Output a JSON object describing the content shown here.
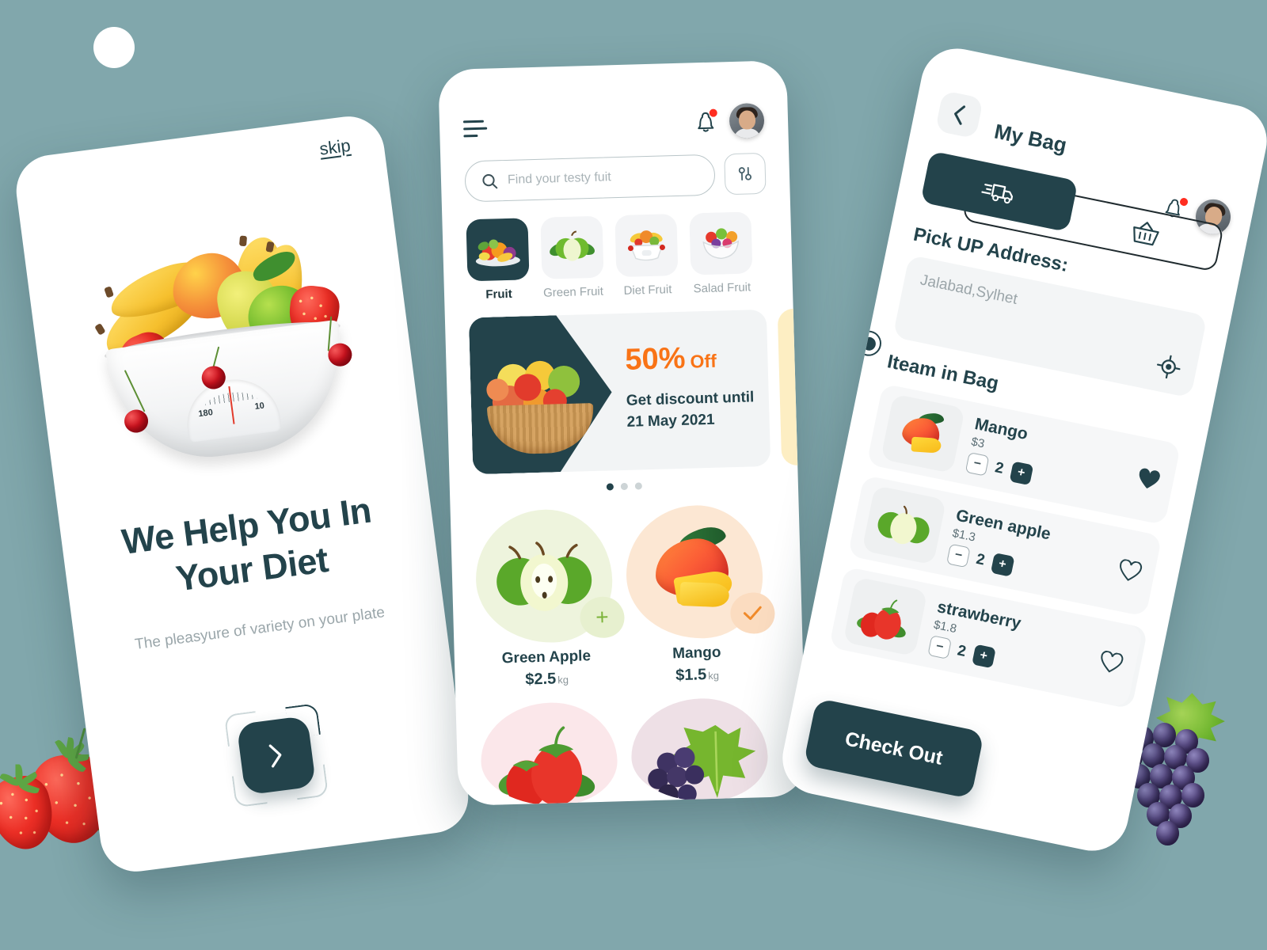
{
  "theme": {
    "background": "#81a7ac",
    "primary_dark": "#23434b",
    "accent_orange": "#f97316",
    "muted_text": "#9aa5a9",
    "card_grey": "#f3f4f6"
  },
  "onboarding": {
    "skip_label": "skip",
    "headline": "We Help You In Your Diet",
    "subtitle": "The pleasyure of variety on your plate",
    "next_icon": "chevron-right-icon",
    "illustration": "fruit-bowl-with-scale",
    "scale_left_number": "180",
    "scale_right_number": "10"
  },
  "home": {
    "menu_icon": "hamburger-menu-icon",
    "bell_icon": "notification-bell-icon",
    "has_notification": true,
    "avatar": "user-avatar",
    "search": {
      "icon": "search-icon",
      "placeholder": "Find your testy fuit",
      "value": ""
    },
    "filter_icon": "filter-sliders-icon",
    "categories": [
      {
        "label": "Fruit",
        "icon": "mixed-fruit-platter",
        "active": true
      },
      {
        "label": "Green Fruit",
        "icon": "green-apple-leaves",
        "active": false
      },
      {
        "label": "Diet Fruit",
        "icon": "fruit-bowl-scale",
        "active": false
      },
      {
        "label": "Salad Fruit",
        "icon": "fruit-salad-bowl",
        "active": false
      }
    ],
    "promo": {
      "percent": "50%",
      "off_label": "Off",
      "text": "Get discount until 21 May 2021",
      "image": "fruit-basket"
    },
    "carousel_dots": 3,
    "carousel_active_index": 0,
    "products": [
      {
        "name": "Green Apple",
        "price": "$2.5",
        "unit": "kg",
        "action": "add",
        "action_icon": "plus-icon"
      },
      {
        "name": "Mango",
        "price": "$1.5",
        "unit": "kg",
        "action": "added",
        "action_icon": "check-icon"
      }
    ],
    "products_next_row": [
      {
        "name": "Strawberry",
        "image": "strawberry"
      },
      {
        "name": "Grapes",
        "image": "grapes"
      }
    ]
  },
  "bag": {
    "back_icon": "chevron-left-icon",
    "title": "My Bag",
    "bell_icon": "notification-bell-icon",
    "has_notification": true,
    "avatar": "user-avatar",
    "tabs": [
      {
        "icon": "delivery-truck-icon",
        "active": true
      },
      {
        "icon": "shopping-basket-icon",
        "active": false
      }
    ],
    "address_label": "Pick UP Address:",
    "address_value": "Jalabad,Sylhet",
    "gps_icon": "locate-target-icon",
    "items_label": "Iteam in Bag",
    "items": [
      {
        "name": "Mango",
        "price": "$3",
        "qty": "2",
        "favorite": true,
        "thumb": "mango",
        "minus": "−",
        "plus": "+"
      },
      {
        "name": "Green apple",
        "price": "$1.3",
        "qty": "2",
        "favorite": false,
        "thumb": "green-apple",
        "minus": "−",
        "plus": "+"
      },
      {
        "name": "strawberry",
        "price": "$1.8",
        "qty": "2",
        "favorite": false,
        "thumb": "strawberry",
        "minus": "−",
        "plus": "+"
      }
    ],
    "delete_icon": "trash-icon",
    "checkout_label": "Check Out"
  }
}
